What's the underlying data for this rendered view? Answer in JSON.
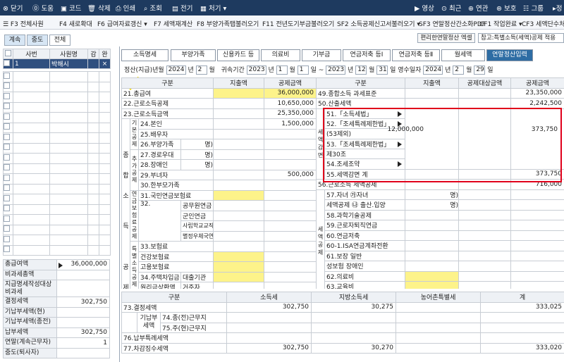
{
  "toolbar": {
    "items": [
      "닫기",
      "도움",
      "코드",
      "삭제",
      "인쇄",
      "조회",
      "전기",
      "처기"
    ],
    "right": [
      "영상",
      "최근",
      "연관",
      "보호",
      "그룹",
      "정"
    ]
  },
  "fkeys": [
    "☰  F3 전체사원",
    "F4 새로확대",
    "F6 급여자료갱신 ▾",
    "F7 세액재계산",
    "F8 부양가족탭불러오기",
    "F11 전년도기부금불러오기",
    "SF2 소득공제신고서불러오기 ▾",
    "SF3 연말정산간소화PDF",
    "CF1 작업완료 ▾",
    "CF3 세액단수처리"
  ],
  "top_tabs": [
    "계속",
    "중도",
    "전체"
  ],
  "right_top": {
    "btn": "편리한연말정산 엑셀",
    "ref": "참고:특별소득(세액)공제 적용"
  },
  "left": {
    "headers": [
      "사번",
      "사원명",
      "감",
      "완"
    ],
    "row1": {
      "id": "1",
      "name": "박해시",
      "x": "×"
    },
    "summary": [
      {
        "label": "총급여액",
        "value": "36,000,000",
        "arrow": true
      },
      {
        "label": "비과세총액",
        "value": ""
      },
      {
        "label": "지급명세작성대상\n비과세",
        "value": ""
      },
      {
        "label": "결정세액",
        "value": "302,750"
      },
      {
        "label": "기납부세액(현)",
        "value": ""
      },
      {
        "label": "기납부세액(종전)",
        "value": ""
      },
      {
        "label": "납부세액",
        "value": "302,750"
      },
      {
        "label": "연말(계속근무자)",
        "value": "1"
      },
      {
        "label": "중도(퇴사자)",
        "value": ""
      }
    ]
  },
  "subtabs": [
    "소득명세",
    "부양가족",
    "신용카드 등",
    "의료비",
    "기부금",
    "연금저축 등Ⅰ",
    "연금저축 등Ⅱ",
    "월세액",
    "연말정산입력"
  ],
  "period": {
    "label1": "정산(지급)년월",
    "y": "2024",
    "n1": "년",
    "m": "2",
    "n2": "월",
    "label2": "귀속기간",
    "fy": "2023",
    "fm": "1",
    "fd": "1",
    "ty": "2023",
    "tm": "12",
    "td": "31",
    "label3": "영수일자",
    "ry": "2024",
    "rm": "2",
    "rd": "29",
    "u_y": "년",
    "u_m": "월",
    "u_d": "일",
    "tilde": "~"
  },
  "mid": {
    "h": [
      "구분",
      "지출액",
      "공제금액"
    ],
    "r21": {
      "l": "21.총급여",
      "v": "36,000,000"
    },
    "r22": {
      "l": "22.근로소득공제",
      "v": "10,650,000"
    },
    "r23": {
      "l": "23.근로소득금액",
      "v": "25,350,000"
    },
    "g1": "기본공제",
    "g2": "추가공제",
    "gz": "종",
    "ga": "합",
    "gs": "소",
    "gd": "득",
    "gg": "공",
    "gr": "제",
    "r24": {
      "l": "24.본인",
      "v": "1,500,000"
    },
    "r25": {
      "l": "25.배우자"
    },
    "r26": {
      "l": "26.부양가족",
      "u": "명)"
    },
    "r27": {
      "l": "27.경로우대",
      "u": "명)"
    },
    "r28": {
      "l": "28.장애인",
      "u": "명)"
    },
    "r29": {
      "l": "29.부녀자",
      "v": "500,000"
    },
    "r30": {
      "l": "30.한부모가족"
    },
    "gp": "연금보험료공제",
    "r31": {
      "l": "31.국민연금보험료"
    },
    "r32": {
      "l": "32.",
      "a": "공무원연금",
      "b": "군인연금",
      "c": "사립학교교직원",
      "d": "별정우체국연금",
      "side": "공적연금보험"
    },
    "gsp": "특별소득공제",
    "r33": {
      "l": "33.보험료",
      "a": "건강보험료",
      "b": "고용보험료"
    },
    "r34": {
      "l": "34.주택차입금",
      "a": "대출기관",
      "b": "원리금상환액",
      "c": "거주자"
    }
  },
  "right": {
    "h": [
      "구분",
      "지출액",
      "공제대상금액",
      "공제금액"
    ],
    "r49": {
      "l": "49.종합소득 과세표준",
      "v": "23,350,000"
    },
    "r50": {
      "l": "50.산출세액",
      "v": "2,242,500"
    },
    "gtax": "세액감면",
    "r51": {
      "l": "51.「소득세법」"
    },
    "r52": {
      "l": "52.「조세특례제한법」",
      "l2": "(53제외)",
      "s": "12,000,000",
      "v": "373,750"
    },
    "r53": {
      "l": "53.「조세특례제한법」",
      "l2": "제30조"
    },
    "r54": {
      "l": "54.조세조약"
    },
    "r55": {
      "l": "55.세액감면 계",
      "v": "373,750"
    },
    "r56": {
      "l": "56.근로소득 세액공제",
      "v": "716,000"
    },
    "r57": {
      "l": "57.자녀",
      "l2": "세액공제",
      "a": "㉮자녀",
      "b": "㉯ 출산.입양",
      "u": "명)"
    },
    "gsec": "세액공제",
    "gyun": "연금계좌",
    "r58": {
      "l": "58.과학기술공제"
    },
    "r59": {
      "l": "59.근로자퇴직연금"
    },
    "r60": {
      "l": "60.연금저축"
    },
    "r601": {
      "l": "60-1.ISA연금계좌전환"
    },
    "gtk": "특",
    "r61": {
      "l": "61.보장",
      "l2": "성보험",
      "a": "일반",
      "b": "장애인"
    },
    "r62": {
      "l": "62.의료비"
    },
    "r63": {
      "l": "63.교육비"
    }
  },
  "bottom": {
    "h": [
      "구분",
      "소득세",
      "지방소득세",
      "농어촌특별세",
      "계"
    ],
    "r73": {
      "l": "73.결정세액",
      "a": "302,750",
      "b": "30,275",
      "d": "333,025"
    },
    "r74": {
      "g": "기납부\n세액",
      "l": "74.종(전)근무지"
    },
    "r75": {
      "l": "75.주(현)근무지"
    },
    "r76": {
      "l": "76.납부특례세액"
    },
    "r77": {
      "l": "77.차감징수세액",
      "a": "302,750",
      "b": "30,270",
      "d": "333,020"
    }
  },
  "colors": {
    "top": "#1e3a5f",
    "highlight": "#fdf38a",
    "red": "#e0001b",
    "active": "#2e6da4"
  }
}
